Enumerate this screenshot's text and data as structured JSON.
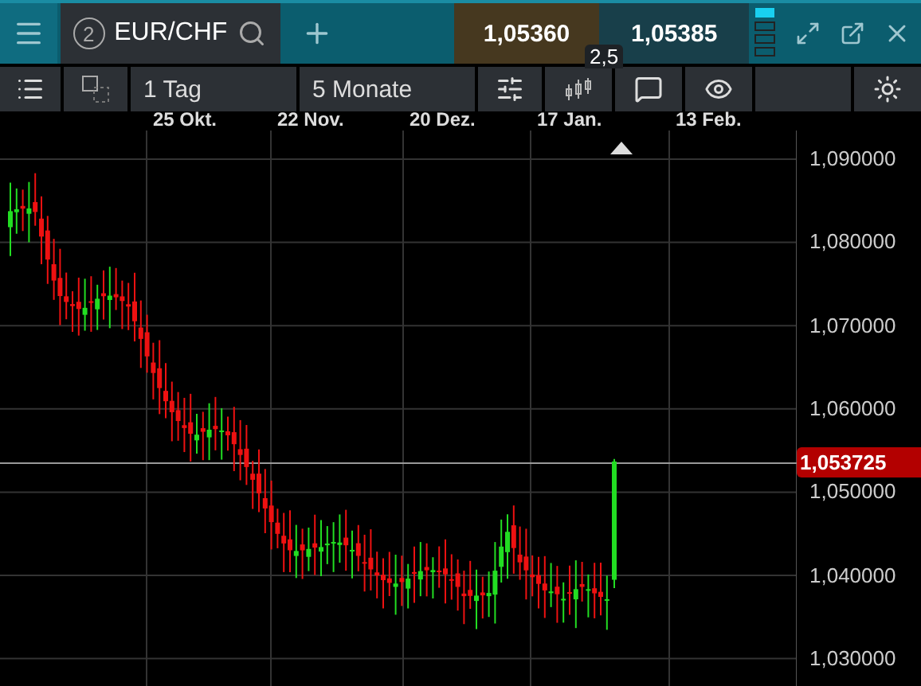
{
  "instrument": {
    "badge": "2",
    "symbol": "EUR/CHF"
  },
  "quote": {
    "bid": "1,05360",
    "ask": "1,05385",
    "spread": "2,5"
  },
  "toolbar": {
    "interval": "1 Tag",
    "range": "5 Monate"
  },
  "chart": {
    "x_labels": [
      "25 Okt.",
      "22 Nov.",
      "20 Dez.",
      "17 Jan.",
      "13 Feb."
    ],
    "y_labels": [
      "1,090000",
      "1,080000",
      "1,070000",
      "1,060000",
      "1,050000",
      "1,040000",
      "1,030000"
    ],
    "last_price": "1,053725"
  }
}
